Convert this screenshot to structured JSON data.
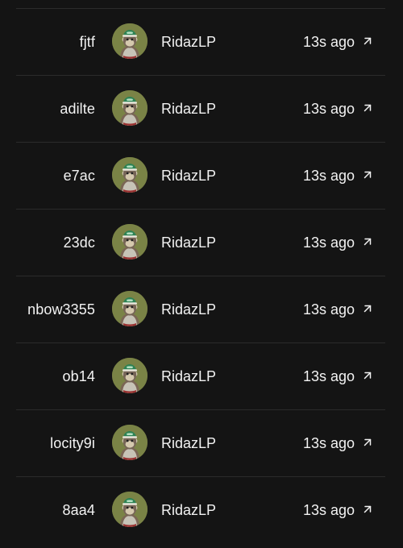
{
  "rows": [
    {
      "item": "fjtf",
      "user": "RidazLP",
      "time": "13s ago",
      "icon": "external-link-icon",
      "avatar": "ape-avatar"
    },
    {
      "item": "adilte",
      "user": "RidazLP",
      "time": "13s ago",
      "icon": "external-link-icon",
      "avatar": "ape-avatar"
    },
    {
      "item": "e7ac",
      "user": "RidazLP",
      "time": "13s ago",
      "icon": "external-link-icon",
      "avatar": "ape-avatar"
    },
    {
      "item": "23dc",
      "user": "RidazLP",
      "time": "13s ago",
      "icon": "external-link-icon",
      "avatar": "ape-avatar"
    },
    {
      "item": "nbow3355",
      "user": "RidazLP",
      "time": "13s ago",
      "icon": "external-link-icon",
      "avatar": "ape-avatar"
    },
    {
      "item": "ob14",
      "user": "RidazLP",
      "time": "13s ago",
      "icon": "external-link-icon",
      "avatar": "ape-avatar"
    },
    {
      "item": "locity9i",
      "user": "RidazLP",
      "time": "13s ago",
      "icon": "external-link-icon",
      "avatar": "ape-avatar"
    },
    {
      "item": "8aa4",
      "user": "RidazLP",
      "time": "13s ago",
      "icon": "external-link-icon",
      "avatar": "ape-avatar"
    }
  ],
  "colors": {
    "background": "#141414",
    "divider": "#2b2b2b",
    "text": "#f2f2f2",
    "avatar_background": "#7a8346"
  }
}
